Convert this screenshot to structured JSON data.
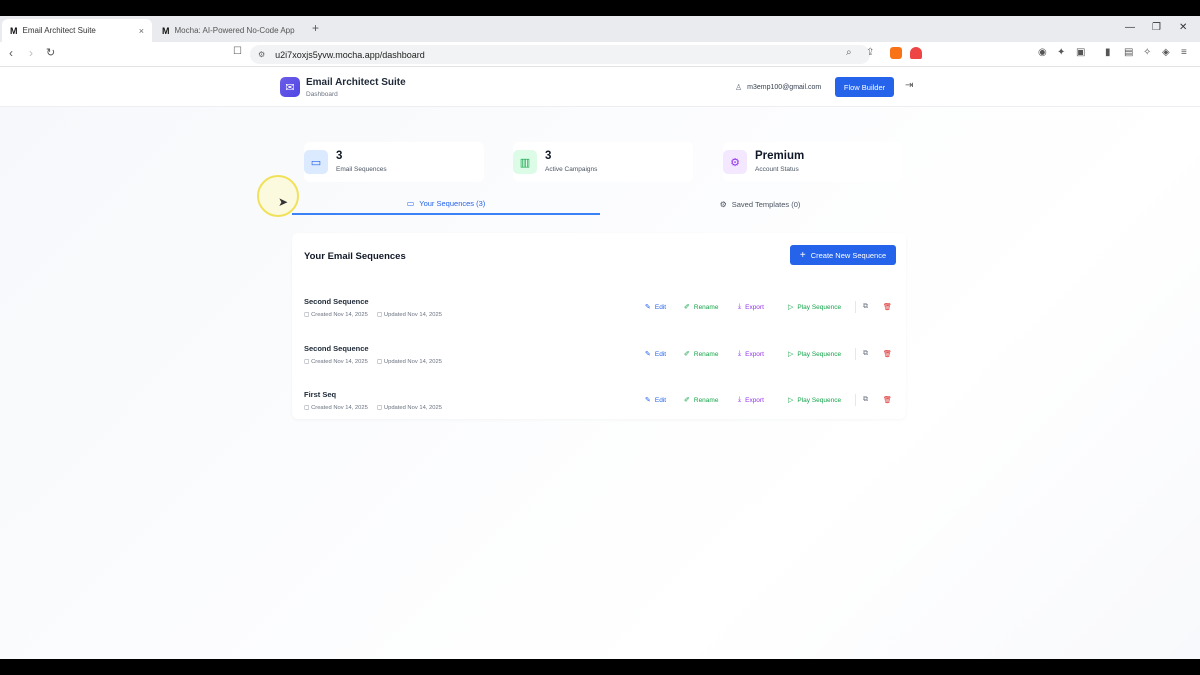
{
  "browser": {
    "tabs": [
      {
        "favicon": "M",
        "title": "Email Architect Suite",
        "close": "×"
      },
      {
        "favicon": "M",
        "title": "Mocha: AI-Powered No-Code App B"
      }
    ],
    "new_tab": "+",
    "url": "u2i7xoxjs5yvw.mocha.app/dashboard"
  },
  "header": {
    "app_title": "Email Architect Suite",
    "app_subtitle": "Dashboard",
    "user_email": "m3emp100@gmail.com",
    "flow_builder_label": "Flow Builder"
  },
  "stats": [
    {
      "value": "3",
      "label": "Email Sequences",
      "icon": "folder-icon",
      "color": "#2563eb",
      "bg": "#dbeafe"
    },
    {
      "value": "3",
      "label": "Active Campaigns",
      "icon": "bar-chart-icon",
      "color": "#16a34a",
      "bg": "#dcfce7"
    },
    {
      "value": "Premium",
      "label": "Account Status",
      "icon": "gear-icon",
      "color": "#9333ea",
      "bg": "#f3e8ff"
    }
  ],
  "tabs": {
    "sequences": "Your Sequences (3)",
    "templates": "Saved Templates (0)"
  },
  "panel": {
    "title": "Your Email Sequences",
    "create_label": "Create New Sequence",
    "actions": {
      "edit": "Edit",
      "rename": "Rename",
      "export": "Export",
      "play": "Play Sequence"
    },
    "sequences": [
      {
        "name": "Second Sequence",
        "created": "Created Nov 14, 2025",
        "updated": "Updated Nov 14, 2025"
      },
      {
        "name": "Second Sequence",
        "created": "Created Nov 14, 2025",
        "updated": "Updated Nov 14, 2025"
      },
      {
        "name": "First Seq",
        "created": "Created Nov 14, 2025",
        "updated": "Updated Nov 14, 2025"
      }
    ]
  }
}
